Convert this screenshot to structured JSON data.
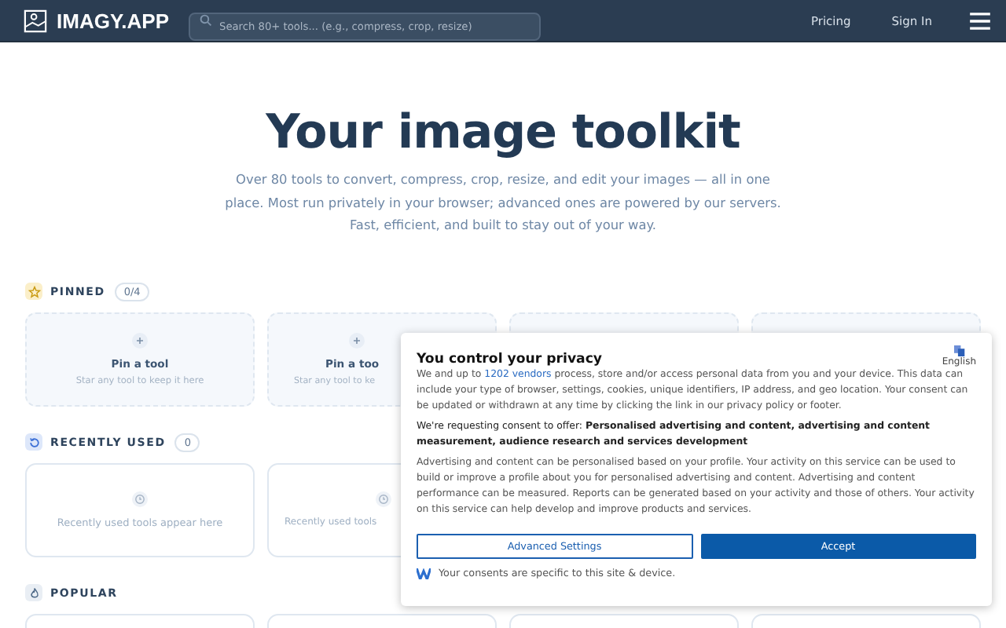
{
  "header": {
    "logo": "IMAGY.APP",
    "search": {
      "placeholder": "Search 80+ tools... (e.g., compress, crop, resize)"
    },
    "links": [
      "Pricing",
      "Sign In"
    ]
  },
  "hero": {
    "title": "Your image toolkit",
    "subtitle": "Over 80 tools to convert, compress, crop, resize, and edit your images — all in one place. Most run privately in your browser; advanced ones are powered by our servers. Fast, efficient, and built to stay out of your way."
  },
  "sections": [
    {
      "kind": "pinned",
      "title": "PINNED",
      "count": "0/4",
      "cards": [
        {
          "kind": "whole",
          "title": "Pin a tool",
          "hint": "Star any tool to keep it here"
        },
        {
          "kind": "clipped",
          "title": "Pin a too",
          "hint": "Star any tool to ke"
        },
        {
          "kind": "covered"
        },
        {
          "kind": "covered"
        }
      ]
    },
    {
      "kind": "recent",
      "title": "RECENTLY USED",
      "count": "0",
      "cards": [
        {
          "kind": "whole",
          "hint": "Recently used tools appear here"
        },
        {
          "kind": "clipped",
          "hint": "Recently used tools"
        }
      ]
    },
    {
      "kind": "popular",
      "title": "POPULAR",
      "cards": [
        {
          "kind": "covered"
        },
        {
          "kind": "covered"
        },
        {
          "kind": "covered"
        },
        {
          "kind": "covered"
        }
      ]
    }
  ],
  "consent": {
    "title": "You control your privacy",
    "language": "English",
    "intro_start": "We and up to",
    "vendors_link": "1202 vendors",
    "intro_end": "process, store and/or access personal data from you and your device. This data can include your type of browser, settings, cookies, unique identifiers, IP address, and geo location. Your consent can be updated or withdrawn at any time by clicking the link in our privacy policy or footer.",
    "purposes": "We're requesting consent to offer: **Personalised advertising and content, advertising and content measurement, audience research and services development**",
    "details": "Advertising and content can be personalised based on your profile. Your activity on this service can be used to build or improve a profile about you for personalised advertising and content. Advertising and content performance can be measured. Reports can be generated based on your activity and those of others. Your activity on this service can help develop and improve products and services.",
    "buttons": [
      "Advanced Settings",
      "Accept"
    ],
    "footer": "Your consents are specific to this site & device."
  }
}
